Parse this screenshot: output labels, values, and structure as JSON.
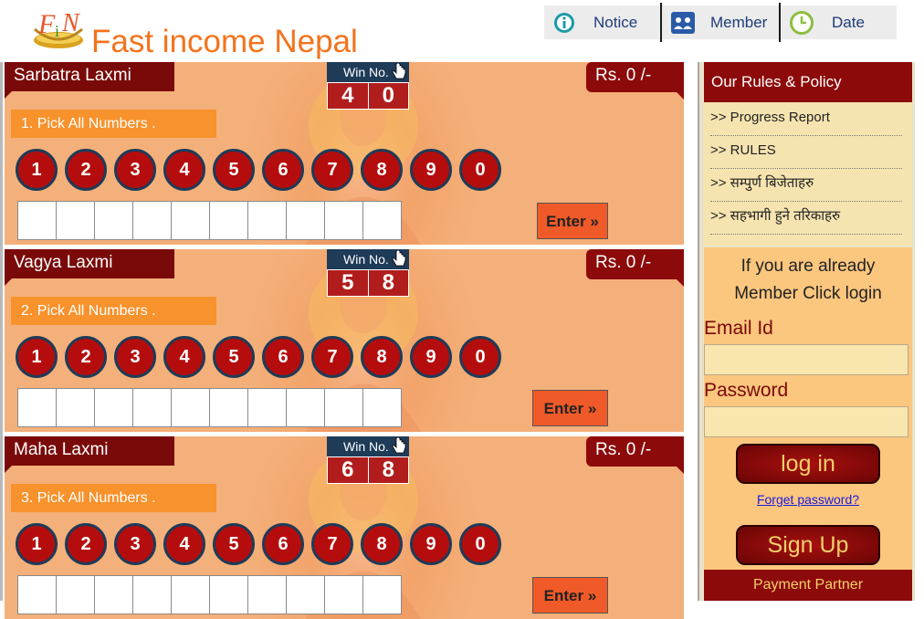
{
  "site": {
    "title": "Fast income Nepal",
    "logo_text": "FiN"
  },
  "nav": [
    {
      "label": "Notice",
      "icon": "info-icon"
    },
    {
      "label": "Member",
      "icon": "users-icon"
    },
    {
      "label": "Date",
      "icon": "clock-icon"
    }
  ],
  "games": [
    {
      "name": "Sarbatra Laxmi",
      "win_label": "Win No.",
      "win_digits": [
        "4",
        "0"
      ],
      "prize": "Rs. 0 /-",
      "pick_label": "1. Pick All Numbers .",
      "numbers": [
        "1",
        "2",
        "3",
        "4",
        "5",
        "6",
        "7",
        "8",
        "9",
        "0"
      ],
      "enter_label": "Enter »"
    },
    {
      "name": "Vagya Laxmi",
      "win_label": "Win No.",
      "win_digits": [
        "5",
        "8"
      ],
      "prize": "Rs. 0 /-",
      "pick_label": "2. Pick All Numbers .",
      "numbers": [
        "1",
        "2",
        "3",
        "4",
        "5",
        "6",
        "7",
        "8",
        "9",
        "0"
      ],
      "enter_label": "Enter »"
    },
    {
      "name": "Maha Laxmi",
      "win_label": "Win No.",
      "win_digits": [
        "6",
        "8"
      ],
      "prize": "Rs. 0 /-",
      "pick_label": "3. Pick All Numbers .",
      "numbers": [
        "1",
        "2",
        "3",
        "4",
        "5",
        "6",
        "7",
        "8",
        "9",
        "0"
      ],
      "enter_label": "Enter »"
    }
  ],
  "sidebar": {
    "rules_title": "Our Rules & Policy",
    "links": [
      ">> Progress Report",
      ">> RULES",
      ">> सम्पुर्ण बिजेताहरु",
      ">> सहभागी हुने तरिकाहरु"
    ],
    "login_intro_1": "If you are already",
    "login_intro_2": "Member Click login",
    "email_label": "Email Id",
    "password_label": "Password",
    "login_button": "log in",
    "forgot_link": "Forget password?",
    "signup_button": "Sign Up",
    "payment_partner": "Payment Partner"
  },
  "colors": {
    "brand_orange": "#f4731c",
    "maroon": "#8d0a0a",
    "ball_red": "#b50d0d",
    "win_navy": "#1e3b58"
  }
}
